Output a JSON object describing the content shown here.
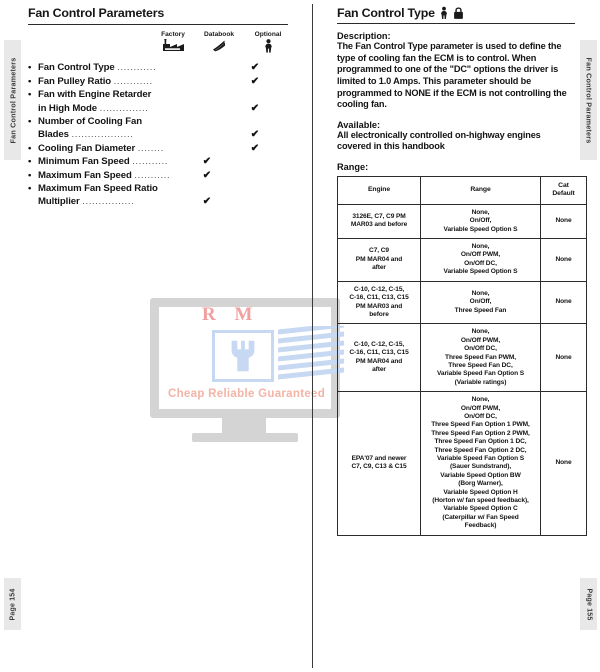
{
  "sidetabs": {
    "left_top": "Fan Control Parameters",
    "right_top": "Fan Control Parameters",
    "left_bottom": "Page 154",
    "right_bottom": "Page 155"
  },
  "watermark": {
    "logo": "R M",
    "tagline": "Cheap Reliable Guaranteed"
  },
  "left": {
    "title": "Fan Control Parameters",
    "columns": [
      {
        "key": "factory",
        "label": "Factory",
        "icon": "factory-icon"
      },
      {
        "key": "databook",
        "label": "Databook",
        "icon": "databook-icon"
      },
      {
        "key": "optional",
        "label": "Optional",
        "icon": "person-icon"
      }
    ],
    "check_glyph": "✔",
    "dots": "................................",
    "parameters": [
      {
        "lines": [
          "Fan Control Type"
        ],
        "dots_on_line": 0,
        "factory": false,
        "databook": false,
        "optional": true
      },
      {
        "lines": [
          "Fan Pulley Ratio"
        ],
        "dots_on_line": 0,
        "factory": false,
        "databook": false,
        "optional": true
      },
      {
        "lines": [
          "Fan with Engine Retarder",
          "in High Mode"
        ],
        "dots_on_line": 1,
        "factory": false,
        "databook": false,
        "optional": true
      },
      {
        "lines": [
          "Number of Cooling Fan",
          "Blades"
        ],
        "dots_on_line": 1,
        "factory": false,
        "databook": false,
        "optional": true
      },
      {
        "lines": [
          "Cooling Fan Diameter"
        ],
        "dots_on_line": 0,
        "factory": false,
        "databook": false,
        "optional": true
      },
      {
        "lines": [
          "Minimum Fan Speed"
        ],
        "dots_on_line": 0,
        "factory": false,
        "databook": true,
        "optional": false
      },
      {
        "lines": [
          "Maximum Fan Speed"
        ],
        "dots_on_line": 0,
        "factory": false,
        "databook": true,
        "optional": false
      },
      {
        "lines": [
          "Maximum Fan Speed Ratio",
          "Multiplier"
        ],
        "dots_on_line": 1,
        "factory": false,
        "databook": true,
        "optional": false
      }
    ]
  },
  "right": {
    "title": "Fan Control Type",
    "title_icons": [
      "person-icon",
      "lock-icon"
    ],
    "description_label": "Description:",
    "description_body": "The Fan Control Type parameter is used to define the type of cooling fan the ECM is to control.  When programmed to one of the \"DC\" options the driver is limited to 1.0 Amps.  This parameter should be programmed to NONE if the ECM is not controlling the cooling fan.",
    "available_label": "Available:",
    "available_body": "All electronically controlled on-highway engines covered in this handbook",
    "range_label": "Range:",
    "table": {
      "headers": [
        "Engine",
        "Range",
        "Cat Default"
      ],
      "header_cat_default_lines": [
        "Cat",
        "Default"
      ],
      "rows": [
        {
          "engine": [
            "3126E, C7, C9 PM",
            "MAR03 and before"
          ],
          "range": [
            "None,",
            "On/Off,",
            "Variable Speed Option S"
          ],
          "default": "None"
        },
        {
          "engine": [
            "C7, C9",
            "PM MAR04 and",
            "after"
          ],
          "range": [
            "None,",
            "On/Off PWM,",
            "On/Off DC,",
            "Variable Speed Option S"
          ],
          "default": "None"
        },
        {
          "engine": [
            "C-10, C-12, C-15,",
            "C-16, C11, C13, C15",
            "PM MAR03 and",
            "before"
          ],
          "range": [
            "None,",
            "On/Off,",
            "Three Speed Fan"
          ],
          "default": "None"
        },
        {
          "engine": [
            "C-10, C-12, C-15,",
            "C-16, C11, C13, C15",
            "PM MAR04 and",
            "after"
          ],
          "range": [
            "None,",
            "On/Off PWM,",
            "On/Off DC,",
            "Three Speed Fan PWM,",
            "Three Speed Fan DC,",
            "Variable Speed Fan Option S",
            "(Variable ratings)"
          ],
          "default": "None"
        },
        {
          "engine": [
            "EPA'07 and newer",
            "C7, C9, C13 & C15"
          ],
          "range": [
            "None,",
            "On/Off PWM,",
            "On/Off DC,",
            "Three Speed Fan Option 1 PWM,",
            "Three Speed Fan Option 2 PWM,",
            "Three Speed Fan Option 1 DC,",
            "Three Speed Fan Option 2 DC,",
            "Variable Speed Fan Option S",
            "(Sauer Sundstrand),",
            "Variable Speed Option BW",
            "(Borg Warner),",
            "Variable Speed Option H",
            "(Horton w/ fan speed feedback),",
            "Variable Speed Option C",
            "(Caterpillar w/ Fan Speed",
            "Feedback)"
          ],
          "default": "None"
        }
      ]
    }
  },
  "colors": {
    "ink": "#141414",
    "rule": "#2a2a2a",
    "tab_bg": "#e8e8e8",
    "watermark_blue": "#c6d8f2",
    "watermark_red": "#f0a0a0"
  }
}
